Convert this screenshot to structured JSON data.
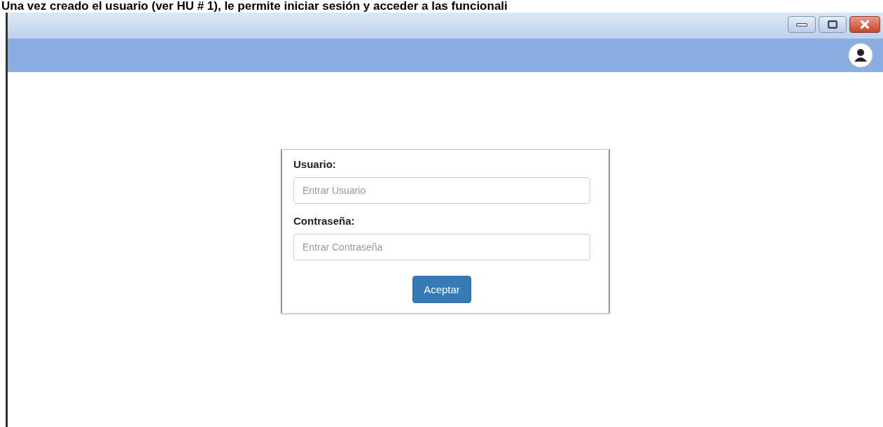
{
  "caption": "Una vez creado el usuario (ver HU # 1), le permite iniciar sesión y acceder a las funcionali",
  "window": {
    "controls": [
      {
        "kind": "minimize"
      },
      {
        "kind": "maximize"
      },
      {
        "kind": "close"
      }
    ]
  },
  "login": {
    "fields": [
      {
        "label": "Usuario:",
        "placeholder": "Entrar Usuario"
      },
      {
        "label": "Contraseña:",
        "placeholder": "Entrar Contraseña"
      }
    ],
    "button": "Aceptar"
  }
}
